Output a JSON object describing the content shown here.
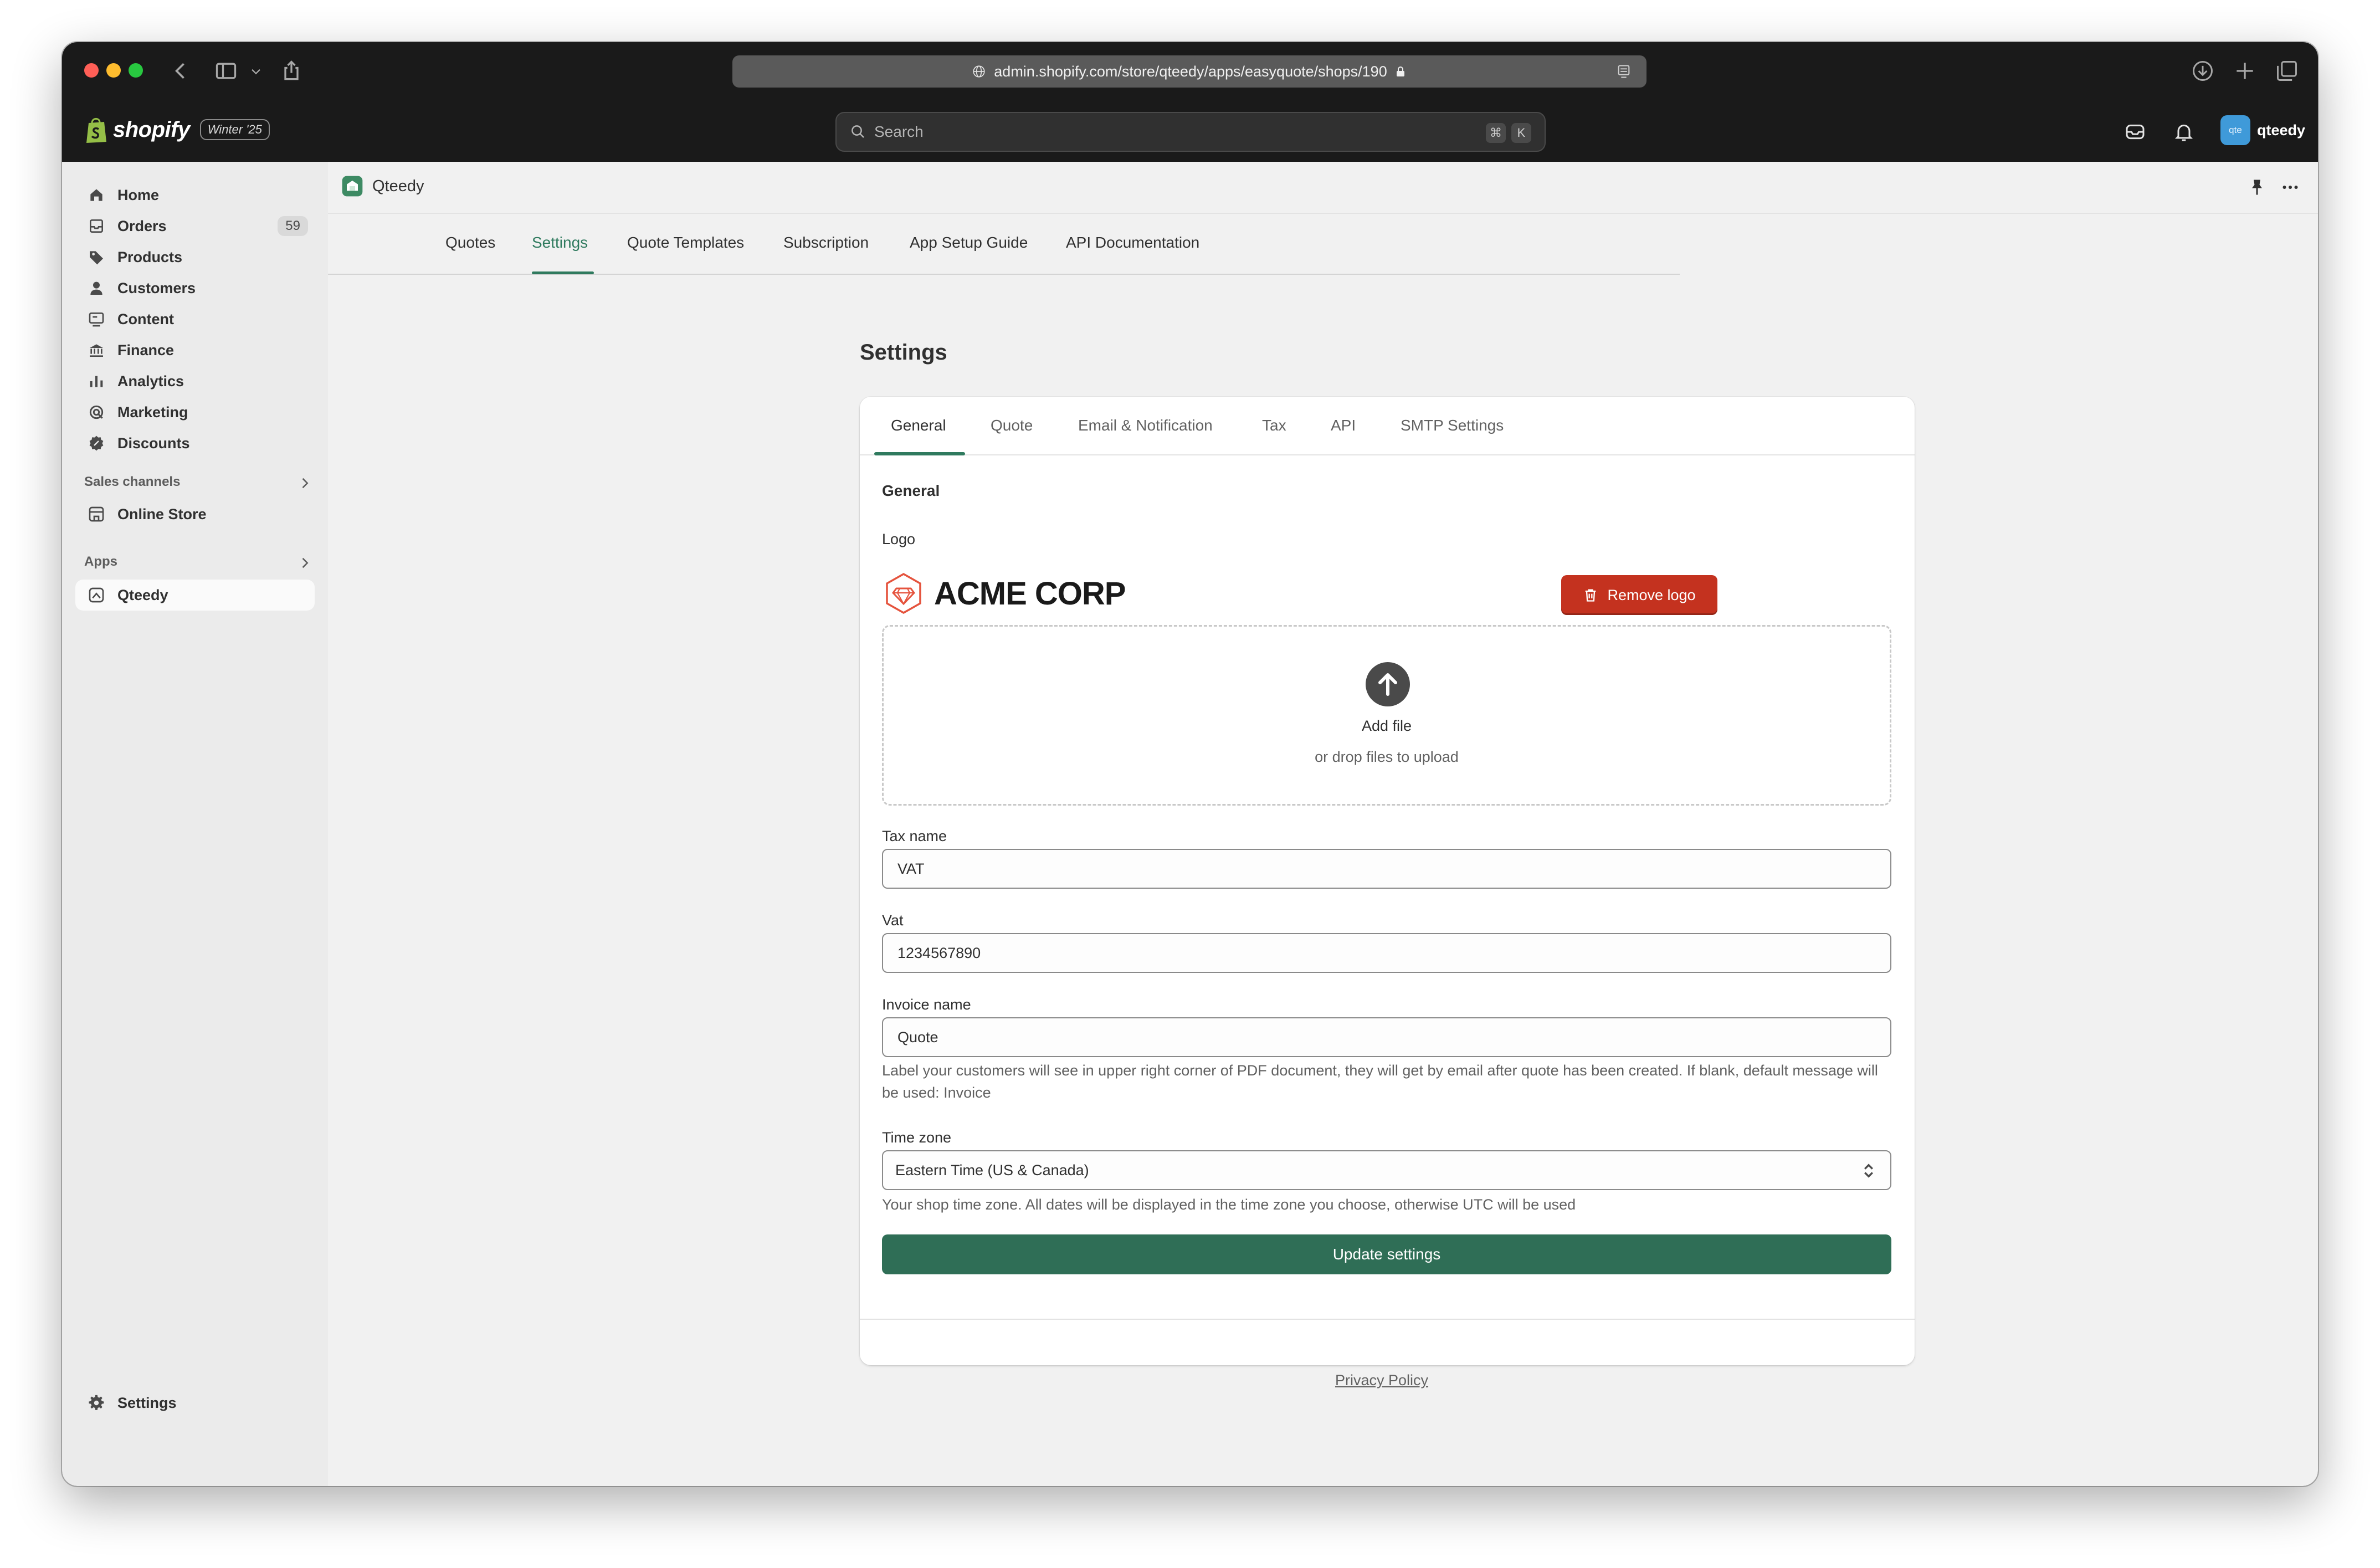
{
  "browser": {
    "url": "admin.shopify.com/store/qteedy/apps/easyquote/shops/190"
  },
  "topbar": {
    "brand": "shopify",
    "edition": "Winter '25",
    "search_placeholder": "Search",
    "shortcut_keys": [
      "⌘",
      "K"
    ],
    "avatar_initials": "qte",
    "user_name": "qteedy"
  },
  "sidebar": {
    "items": [
      {
        "label": "Home",
        "icon": "home-icon"
      },
      {
        "label": "Orders",
        "icon": "orders-icon",
        "badge": "59"
      },
      {
        "label": "Products",
        "icon": "tag-icon"
      },
      {
        "label": "Customers",
        "icon": "person-icon"
      },
      {
        "label": "Content",
        "icon": "content-icon"
      },
      {
        "label": "Finance",
        "icon": "bank-icon"
      },
      {
        "label": "Analytics",
        "icon": "bar-chart-icon"
      },
      {
        "label": "Marketing",
        "icon": "target-icon"
      },
      {
        "label": "Discounts",
        "icon": "discount-icon"
      }
    ],
    "sales_channels_label": "Sales channels",
    "sales_channels": [
      {
        "label": "Online Store",
        "icon": "store-icon"
      }
    ],
    "apps_label": "Apps",
    "apps": [
      {
        "label": "Qteedy",
        "icon": "app-icon"
      }
    ],
    "settings_label": "Settings"
  },
  "app": {
    "name": "Qteedy",
    "tabs": [
      "Quotes",
      "Settings",
      "Quote Templates",
      "Subscription",
      "App Setup Guide",
      "API Documentation"
    ],
    "active_tab": "Settings"
  },
  "settings": {
    "title": "Settings",
    "tabs": [
      "General",
      "Quote",
      "Email & Notification",
      "Tax",
      "API",
      "SMTP Settings"
    ],
    "active_tab": "General",
    "section_title": "General",
    "logo_label": "Logo",
    "company_name": "ACME CORP",
    "remove_logo_label": "Remove logo",
    "add_file_label": "Add file",
    "drop_hint": "or drop files to upload",
    "tax_name_label": "Tax name",
    "tax_name_value": "VAT",
    "vat_label": "Vat",
    "vat_value": "1234567890",
    "invoice_name_label": "Invoice name",
    "invoice_name_value": "Quote",
    "invoice_help": "Label your customers will see in upper right corner of PDF document, they will get by email after quote has been created. If blank, default message will be used: Invoice",
    "timezone_label": "Time zone",
    "timezone_value": "Eastern Time (US & Canada)",
    "timezone_help": "Your shop time zone. All dates will be displayed in the time zone you choose, otherwise UTC will be used",
    "update_label": "Update settings",
    "privacy_label": "Privacy Policy"
  },
  "colors": {
    "accent": "#2f7a5e",
    "danger": "#c4321f",
    "primary_button": "#2f6e56"
  }
}
